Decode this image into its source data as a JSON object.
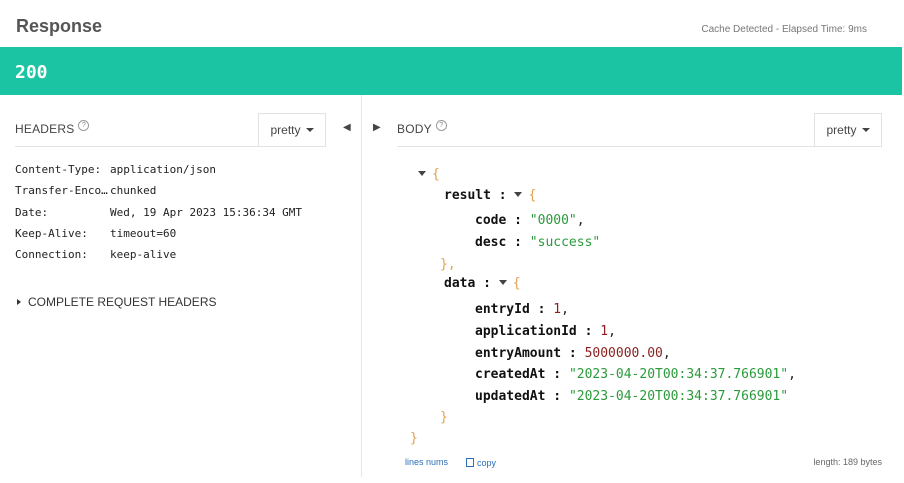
{
  "header": {
    "title": "Response",
    "meta": "Cache Detected - Elapsed Time: 9ms"
  },
  "status": {
    "code": "200",
    "color": "#1bc4a2"
  },
  "headers_panel": {
    "label": "HEADERS",
    "help": "?",
    "format": "pretty",
    "rows": [
      {
        "key": "Content-Type:",
        "value": "application/json"
      },
      {
        "key": "Transfer-Enco…",
        "value": "chunked"
      },
      {
        "key": "Date:",
        "value": "Wed, 19 Apr 2023 15:36:34 GMT"
      },
      {
        "key": "Keep-Alive:",
        "value": "timeout=60"
      },
      {
        "key": "Connection:",
        "value": "keep-alive"
      }
    ],
    "complete_label": "COMPLETE REQUEST HEADERS"
  },
  "body_panel": {
    "label": "BODY",
    "help": "?",
    "format": "pretty",
    "json": {
      "open": "{",
      "close": "}",
      "result": {
        "key": "result",
        "open": "{",
        "close": "},",
        "fields": [
          {
            "key": "code",
            "value": "\"0000\"",
            "sep": ",",
            "type": "str"
          },
          {
            "key": "desc",
            "value": "\"success\"",
            "sep": "",
            "type": "str"
          }
        ]
      },
      "data": {
        "key": "data",
        "open": "{",
        "close": "}",
        "fields": [
          {
            "key": "entryId",
            "value": "1",
            "sep": ",",
            "type": "num"
          },
          {
            "key": "applicationId",
            "value": "1",
            "sep": ",",
            "type": "num"
          },
          {
            "key": "entryAmount",
            "value": "5000000.00",
            "sep": ",",
            "type": "num"
          },
          {
            "key": "createdAt",
            "value": "\"2023-04-20T00:34:37.766901\"",
            "sep": ",",
            "type": "str"
          },
          {
            "key": "updatedAt",
            "value": "\"2023-04-20T00:34:37.766901\"",
            "sep": "",
            "type": "str"
          }
        ]
      }
    },
    "footer": {
      "lines_nums": "lines nums",
      "copy": "copy",
      "length": "length: 189 bytes"
    }
  }
}
